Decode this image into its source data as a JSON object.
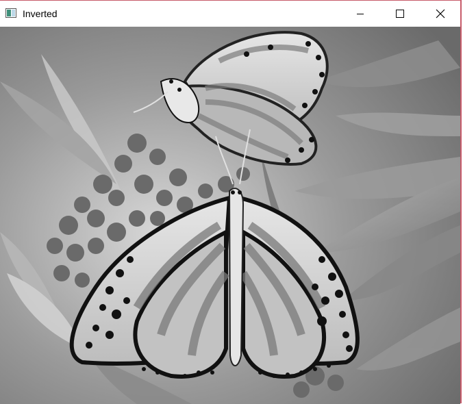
{
  "window": {
    "title": "Inverted",
    "controls": {
      "minimize": "minimize",
      "maximize": "maximize",
      "close": "close"
    }
  },
  "image": {
    "subject": "inverted-butterflies-on-flowers",
    "tone": "grayscale"
  }
}
